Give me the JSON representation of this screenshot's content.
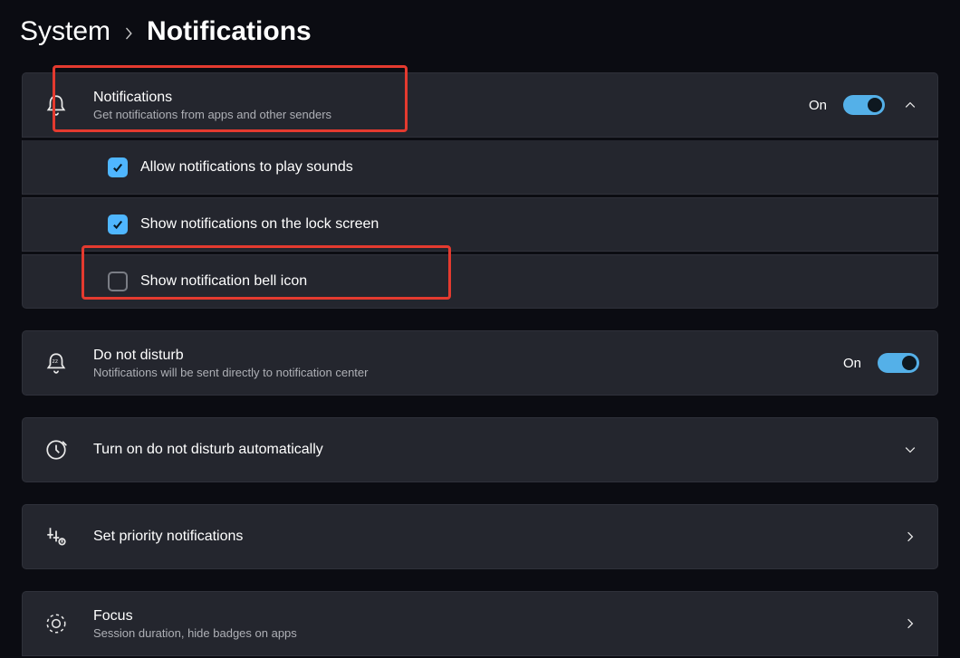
{
  "breadcrumb": {
    "root": "System",
    "current": "Notifications"
  },
  "states": {
    "on": "On"
  },
  "cards": {
    "notifications": {
      "title": "Notifications",
      "subtitle": "Get notifications from apps and other senders"
    },
    "sub_sounds": {
      "label": "Allow notifications to play sounds"
    },
    "sub_lockscreen": {
      "label": "Show notifications on the lock screen"
    },
    "sub_bell": {
      "label": "Show notification bell icon"
    },
    "dnd": {
      "title": "Do not disturb",
      "subtitle": "Notifications will be sent directly to notification center"
    },
    "dnd_auto": {
      "title": "Turn on do not disturb automatically"
    },
    "priority": {
      "title": "Set priority notifications"
    },
    "focus": {
      "title": "Focus",
      "subtitle": "Session duration, hide badges on apps"
    }
  }
}
